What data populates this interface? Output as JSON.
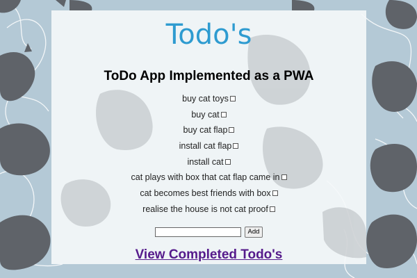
{
  "app": {
    "title": "Todo's",
    "subtitle": "ToDo App Implemented as a PWA"
  },
  "todos": [
    {
      "text": "buy cat toys",
      "completed": false
    },
    {
      "text": "buy cat",
      "completed": false
    },
    {
      "text": "buy cat flap",
      "completed": false
    },
    {
      "text": "install cat flap",
      "completed": false
    },
    {
      "text": "install cat",
      "completed": false
    },
    {
      "text": "cat plays with box that cat flap came in",
      "completed": false
    },
    {
      "text": "cat becomes best friends with box",
      "completed": false
    },
    {
      "text": "realise the house is not cat proof",
      "completed": false
    }
  ],
  "add_form": {
    "input_value": "",
    "button_label": "Add"
  },
  "completed_link": {
    "label": "View Completed Todo's"
  },
  "theme": {
    "background": "#b4c9d6",
    "cat_silhouette": "#5f6369",
    "title_color": "#2e9bd0",
    "link_color": "#551a8b"
  }
}
